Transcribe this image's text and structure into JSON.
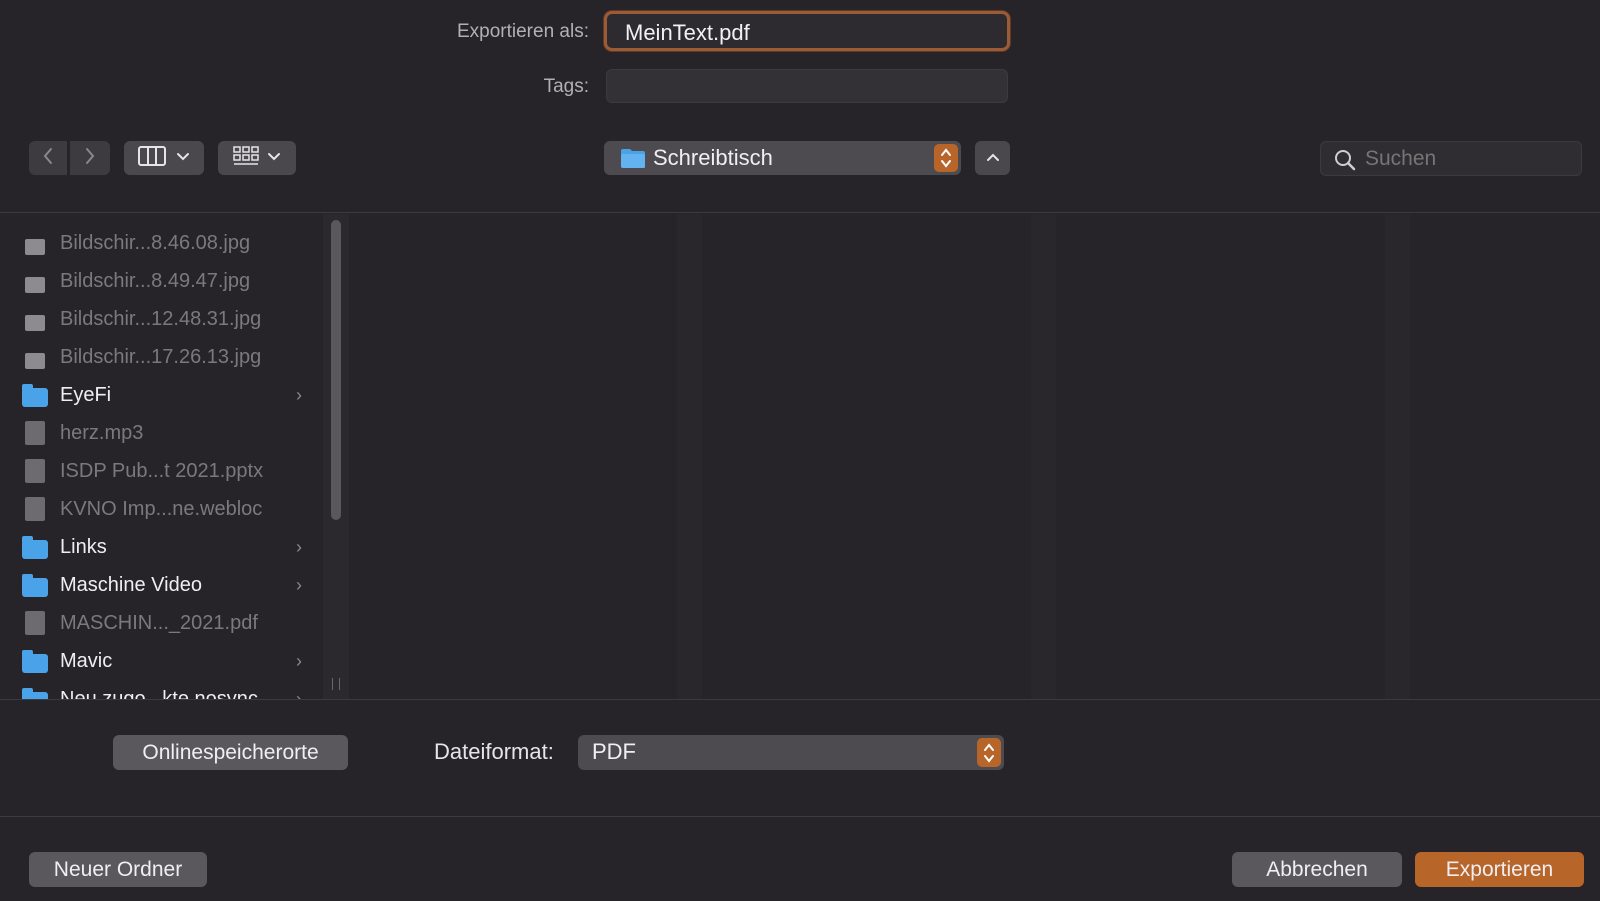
{
  "header": {
    "export_as_label": "Exportieren als:",
    "filename_value": "MeinText.pdf",
    "tags_label": "Tags:",
    "tags_value": ""
  },
  "toolbar": {
    "location": "Schreibtisch",
    "search_placeholder": "Suchen"
  },
  "sidebar": {
    "items": [
      {
        "label": "Bildschir...8.46.08.jpg",
        "kind": "image",
        "enabled": false
      },
      {
        "label": "Bildschir...8.49.47.jpg",
        "kind": "image",
        "enabled": false
      },
      {
        "label": "Bildschir...12.48.31.jpg",
        "kind": "image",
        "enabled": false
      },
      {
        "label": "Bildschir...17.26.13.jpg",
        "kind": "image",
        "enabled": false
      },
      {
        "label": "EyeFi",
        "kind": "folder",
        "enabled": true
      },
      {
        "label": "herz.mp3",
        "kind": "file",
        "enabled": false
      },
      {
        "label": "ISDP Pub...t 2021.pptx",
        "kind": "file",
        "enabled": false
      },
      {
        "label": "KVNO Imp...ne.webloc",
        "kind": "file",
        "enabled": false
      },
      {
        "label": "Links",
        "kind": "folder",
        "enabled": true
      },
      {
        "label": "Maschine Video",
        "kind": "folder",
        "enabled": true
      },
      {
        "label": "MASCHIN..._2021.pdf",
        "kind": "file",
        "enabled": false
      },
      {
        "label": "Mavic",
        "kind": "folder",
        "enabled": true
      },
      {
        "label": "Neu zugo...kte.nosync",
        "kind": "folder",
        "enabled": true
      }
    ]
  },
  "options": {
    "online_locations_label": "Onlinespeicherorte",
    "file_format_label": "Dateiformat:",
    "file_format_value": "PDF"
  },
  "footer": {
    "new_folder_label": "Neuer Ordner",
    "cancel_label": "Abbrechen",
    "export_label": "Exportieren"
  },
  "colors": {
    "background": "#262429",
    "accent": "#b8652a",
    "folder": "#4aa3e8"
  }
}
